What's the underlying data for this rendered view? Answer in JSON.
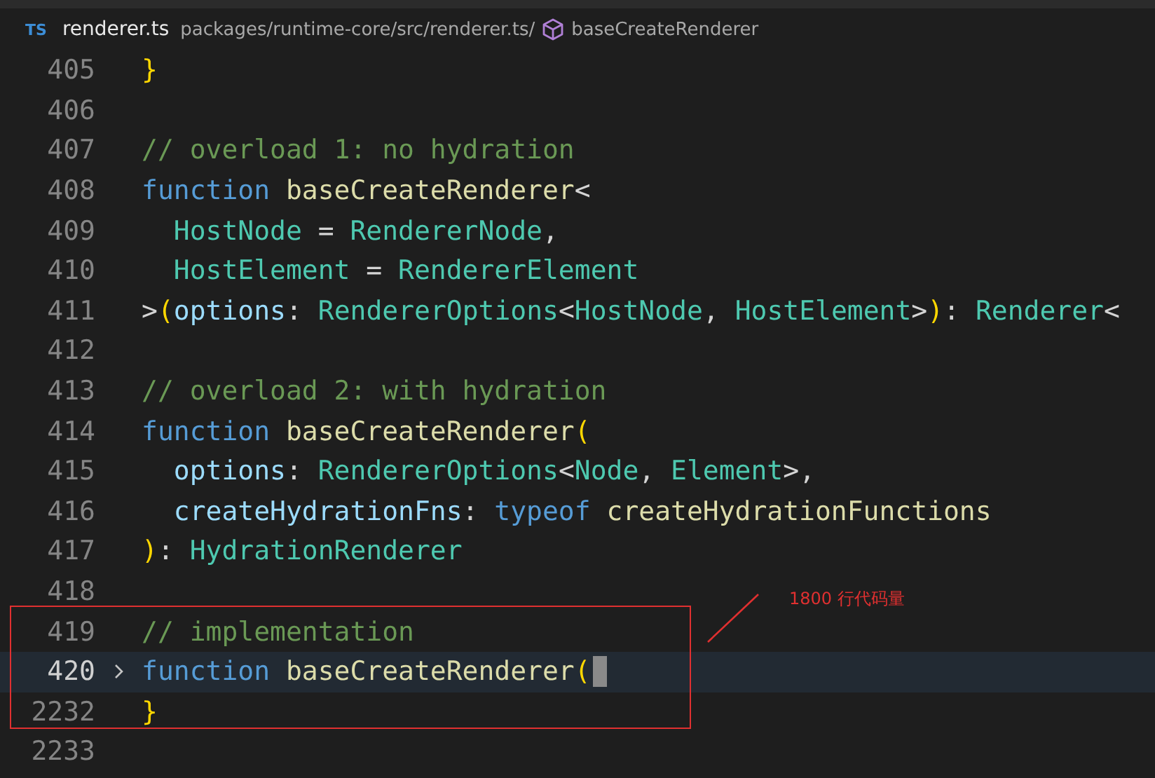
{
  "breadcrumb": {
    "file_badge": "TS",
    "file_name": "renderer.ts",
    "path": "packages/runtime-core/src/renderer.ts/",
    "symbol": "baseCreateRenderer"
  },
  "lines": [
    {
      "number": "405",
      "current": false,
      "collapsed": false,
      "indent": false,
      "tokens": [
        {
          "kind": "bracket",
          "text": "}",
          "gap": false
        }
      ]
    },
    {
      "number": "406",
      "current": false,
      "collapsed": false
    },
    {
      "number": "407",
      "current": false,
      "collapsed": false,
      "indent": false,
      "tokens": [
        {
          "kind": "comment",
          "text": "// overload 1: no hydration",
          "gap": false
        }
      ]
    },
    {
      "number": "408",
      "current": false,
      "collapsed": false,
      "indent": false,
      "tokens": [
        {
          "kind": "keyword",
          "text": "function",
          "gap": false
        },
        {
          "kind": "func",
          "text": "baseCreateRenderer",
          "gap": true
        },
        {
          "kind": "plain",
          "text": "<",
          "gap": false
        }
      ]
    },
    {
      "number": "409",
      "current": false,
      "collapsed": false,
      "indent": true,
      "tokens": [
        {
          "kind": "type",
          "text": "HostNode",
          "gap": false
        },
        {
          "kind": "plain",
          "text": "=",
          "gap": true
        },
        {
          "kind": "type",
          "text": "RendererNode",
          "gap": true
        },
        {
          "kind": "plain",
          "text": ",",
          "gap": false
        }
      ]
    },
    {
      "number": "410",
      "current": false,
      "collapsed": false,
      "indent": true,
      "tokens": [
        {
          "kind": "type",
          "text": "HostElement",
          "gap": false
        },
        {
          "kind": "plain",
          "text": "=",
          "gap": true
        },
        {
          "kind": "type",
          "text": "RendererElement",
          "gap": true
        }
      ]
    },
    {
      "number": "411",
      "current": false,
      "collapsed": false,
      "indent": false,
      "tokens": [
        {
          "kind": "plain",
          "text": ">",
          "gap": false
        },
        {
          "kind": "bracket",
          "text": "(",
          "gap": false
        },
        {
          "kind": "param",
          "text": "options",
          "gap": false
        },
        {
          "kind": "plain",
          "text": ":",
          "gap": false
        },
        {
          "kind": "type",
          "text": "RendererOptions",
          "gap": true
        },
        {
          "kind": "plain",
          "text": "<",
          "gap": false
        },
        {
          "kind": "type",
          "text": "HostNode",
          "gap": false
        },
        {
          "kind": "plain",
          "text": ",",
          "gap": false
        },
        {
          "kind": "type",
          "text": "HostElement",
          "gap": true
        },
        {
          "kind": "plain",
          "text": ">",
          "gap": false
        },
        {
          "kind": "bracket",
          "text": ")",
          "gap": false
        },
        {
          "kind": "plain",
          "text": ":",
          "gap": false
        },
        {
          "kind": "type",
          "text": "Renderer",
          "gap": true
        },
        {
          "kind": "plain",
          "text": "<",
          "gap": false
        }
      ]
    },
    {
      "number": "412",
      "current": false,
      "collapsed": false
    },
    {
      "number": "413",
      "current": false,
      "collapsed": false,
      "indent": false,
      "tokens": [
        {
          "kind": "comment",
          "text": "// overload 2: with hydration",
          "gap": false
        }
      ]
    },
    {
      "number": "414",
      "current": false,
      "collapsed": false,
      "indent": false,
      "tokens": [
        {
          "kind": "keyword",
          "text": "function",
          "gap": false
        },
        {
          "kind": "func",
          "text": "baseCreateRenderer",
          "gap": true
        },
        {
          "kind": "bracket",
          "text": "(",
          "gap": false
        }
      ]
    },
    {
      "number": "415",
      "current": false,
      "collapsed": false,
      "indent": true,
      "tokens": [
        {
          "kind": "param",
          "text": "options",
          "gap": false
        },
        {
          "kind": "plain",
          "text": ":",
          "gap": false
        },
        {
          "kind": "type",
          "text": "RendererOptions",
          "gap": true
        },
        {
          "kind": "plain",
          "text": "<",
          "gap": false
        },
        {
          "kind": "type",
          "text": "Node",
          "gap": false
        },
        {
          "kind": "plain",
          "text": ",",
          "gap": false
        },
        {
          "kind": "type",
          "text": "Element",
          "gap": true
        },
        {
          "kind": "plain",
          "text": ">,",
          "gap": false
        }
      ]
    },
    {
      "number": "416",
      "current": false,
      "collapsed": false,
      "indent": true,
      "tokens": [
        {
          "kind": "param",
          "text": "createHydrationFns",
          "gap": false
        },
        {
          "kind": "plain",
          "text": ":",
          "gap": false
        },
        {
          "kind": "keyword",
          "text": "typeof",
          "gap": true
        },
        {
          "kind": "func",
          "text": "createHydrationFunctions",
          "gap": true
        }
      ]
    },
    {
      "number": "417",
      "current": false,
      "collapsed": false,
      "indent": false,
      "tokens": [
        {
          "kind": "bracket",
          "text": ")",
          "gap": false
        },
        {
          "kind": "plain",
          "text": ":",
          "gap": false
        },
        {
          "kind": "type",
          "text": "HydrationRenderer",
          "gap": true
        }
      ]
    },
    {
      "number": "418",
      "current": false,
      "collapsed": false
    },
    {
      "number": "419",
      "current": false,
      "collapsed": false,
      "indent": false,
      "tokens": [
        {
          "kind": "comment",
          "text": "// implementation",
          "gap": false
        }
      ]
    },
    {
      "number": "420",
      "current": true,
      "collapsed": true,
      "indent": false,
      "tokens": [
        {
          "kind": "keyword",
          "text": "function",
          "gap": false
        },
        {
          "kind": "func",
          "text": "baseCreateRenderer",
          "gap": true
        },
        {
          "kind": "bracket",
          "text": "(",
          "gap": false
        }
      ]
    },
    {
      "number": "2232",
      "current": false,
      "collapsed": false,
      "indent": false,
      "tokens": [
        {
          "kind": "bracket",
          "text": "}",
          "gap": false
        }
      ]
    },
    {
      "number": "2233",
      "current": false,
      "collapsed": false
    }
  ],
  "annotation": {
    "label": "1800 行代码量"
  }
}
